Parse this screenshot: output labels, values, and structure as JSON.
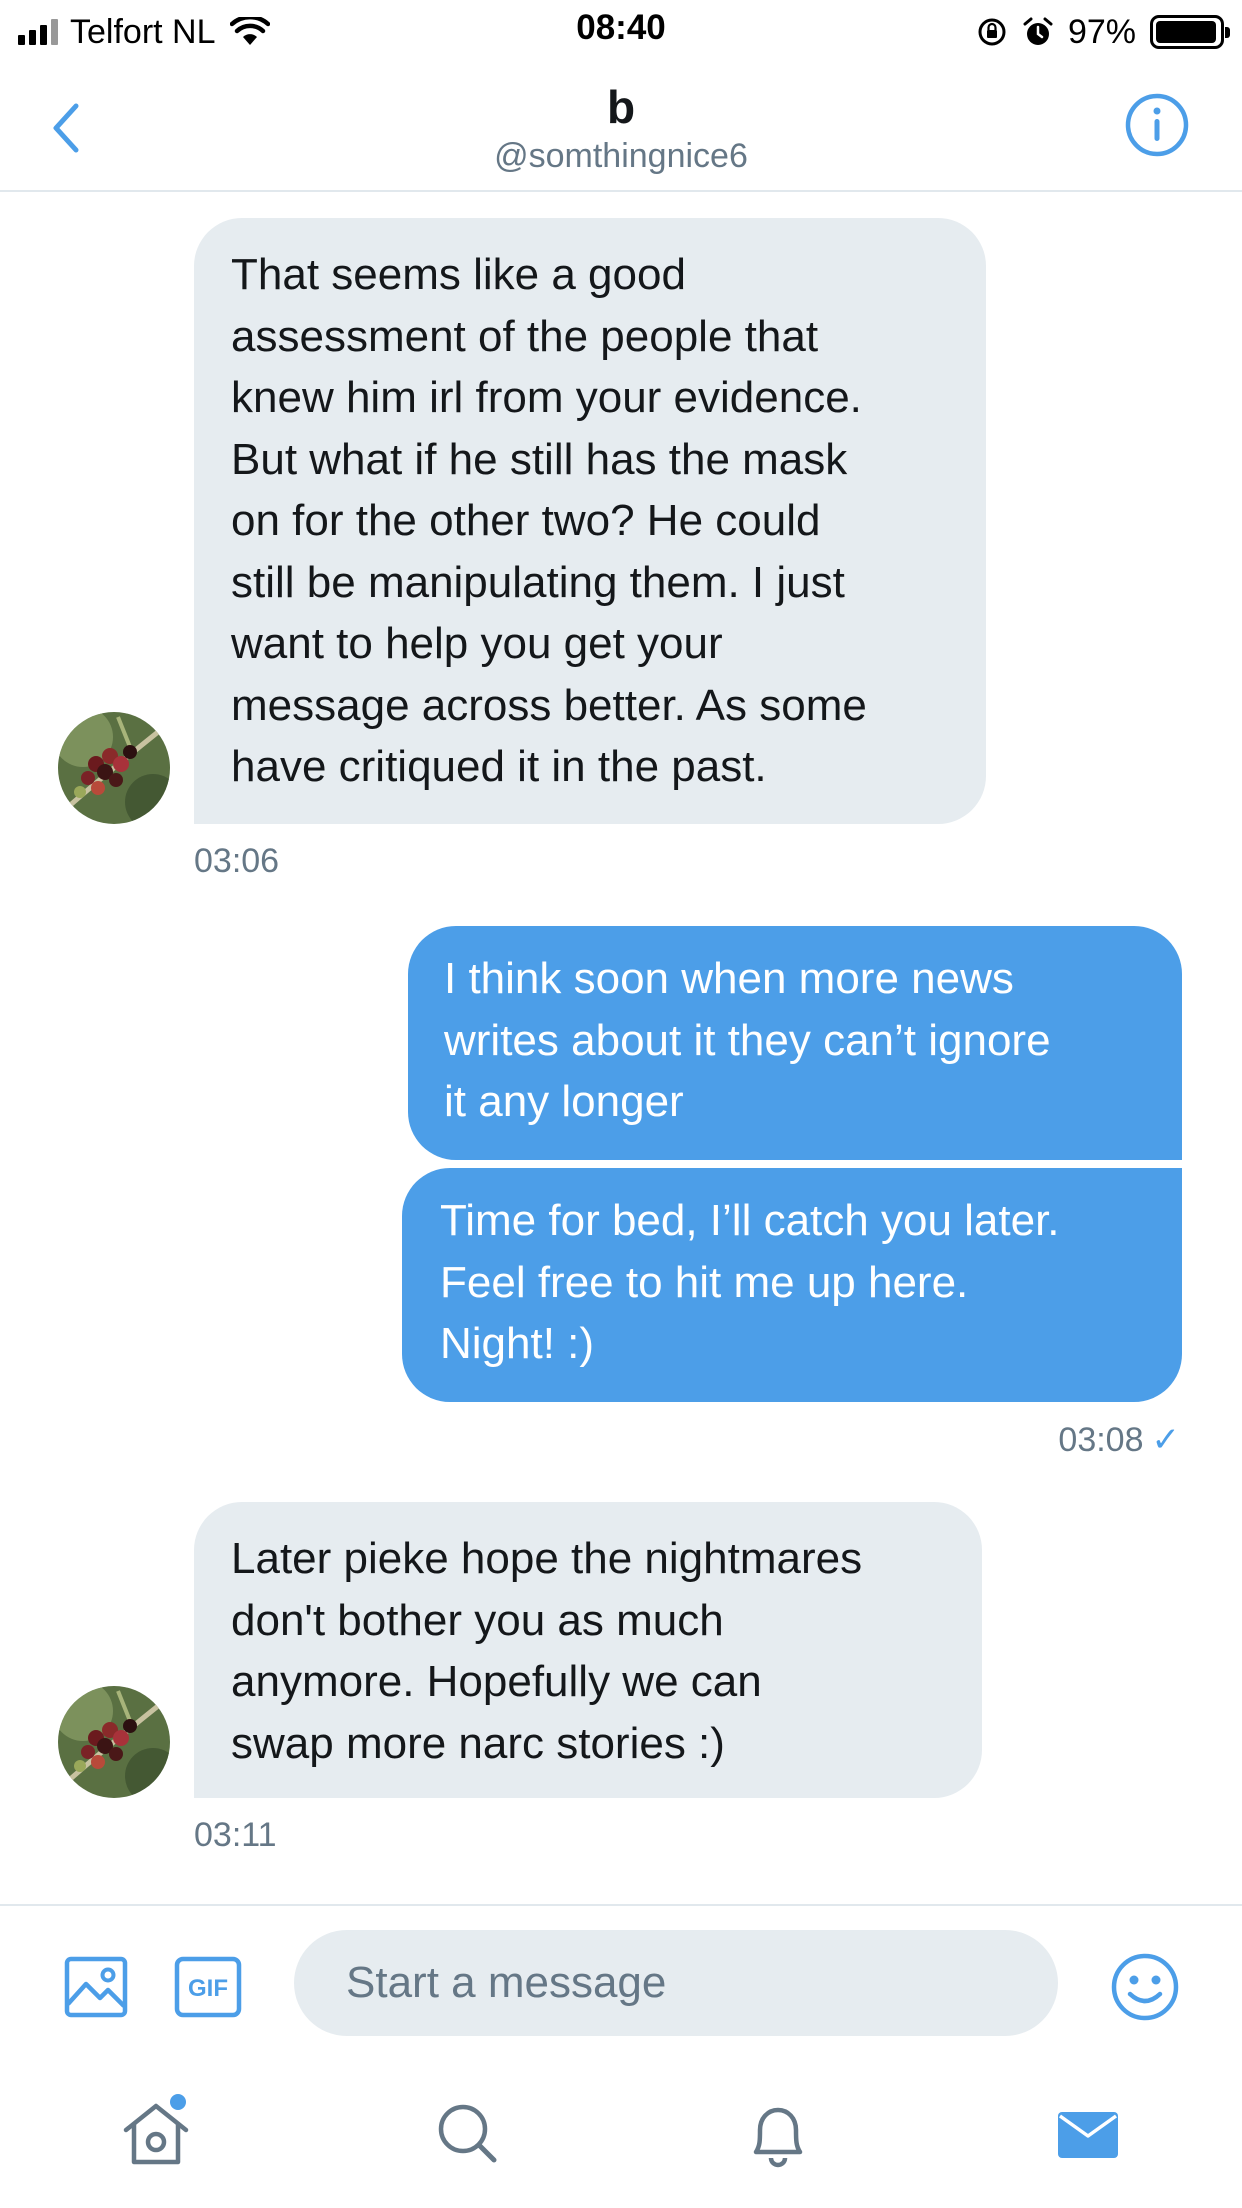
{
  "status_bar": {
    "carrier": "Telfort NL",
    "time": "08:40",
    "battery": "97%",
    "battery_level": 0.97
  },
  "header": {
    "title": "b",
    "handle": "@somthingnice6",
    "back_icon": "chevron-left-icon",
    "info_icon": "info-circle-icon"
  },
  "messages": [
    {
      "direction": "received",
      "lines": [
        "That seems like a good",
        "assessment of the people that",
        "knew him irl from your evidence.",
        "But what if he still has the mask",
        "on for the other two? He could",
        "still be manipulating them. I just",
        "want to help you get your",
        "message across better. As some",
        "have critiqued it in the past."
      ],
      "time": "03:06"
    },
    {
      "direction": "sent",
      "lines": [
        "I think soon when more news",
        "writes about it they can’t ignore",
        "it any longer"
      ]
    },
    {
      "direction": "sent",
      "lines": [
        "Time for bed, I’ll catch you later.",
        "Feel free to hit me up here.",
        "Night! :)"
      ],
      "time": "03:08",
      "status": "✓"
    },
    {
      "direction": "received",
      "lines": [
        "Later pieke hope the nightmares",
        "don't bother you as much",
        "anymore. Hopefully we can",
        "swap more narc stories :)"
      ],
      "time": "03:11"
    }
  ],
  "composer": {
    "placeholder": "Start a message",
    "gif_label": "GIF"
  },
  "tabbar": {
    "items": [
      "home-icon",
      "search-icon",
      "bell-icon",
      "mail-icon"
    ],
    "active": "mail-icon"
  },
  "colors": {
    "accent": "#4c9ee8",
    "received_bubble": "#e6ecf0",
    "secondary_text": "#657786",
    "icon_gray": "#657786"
  }
}
